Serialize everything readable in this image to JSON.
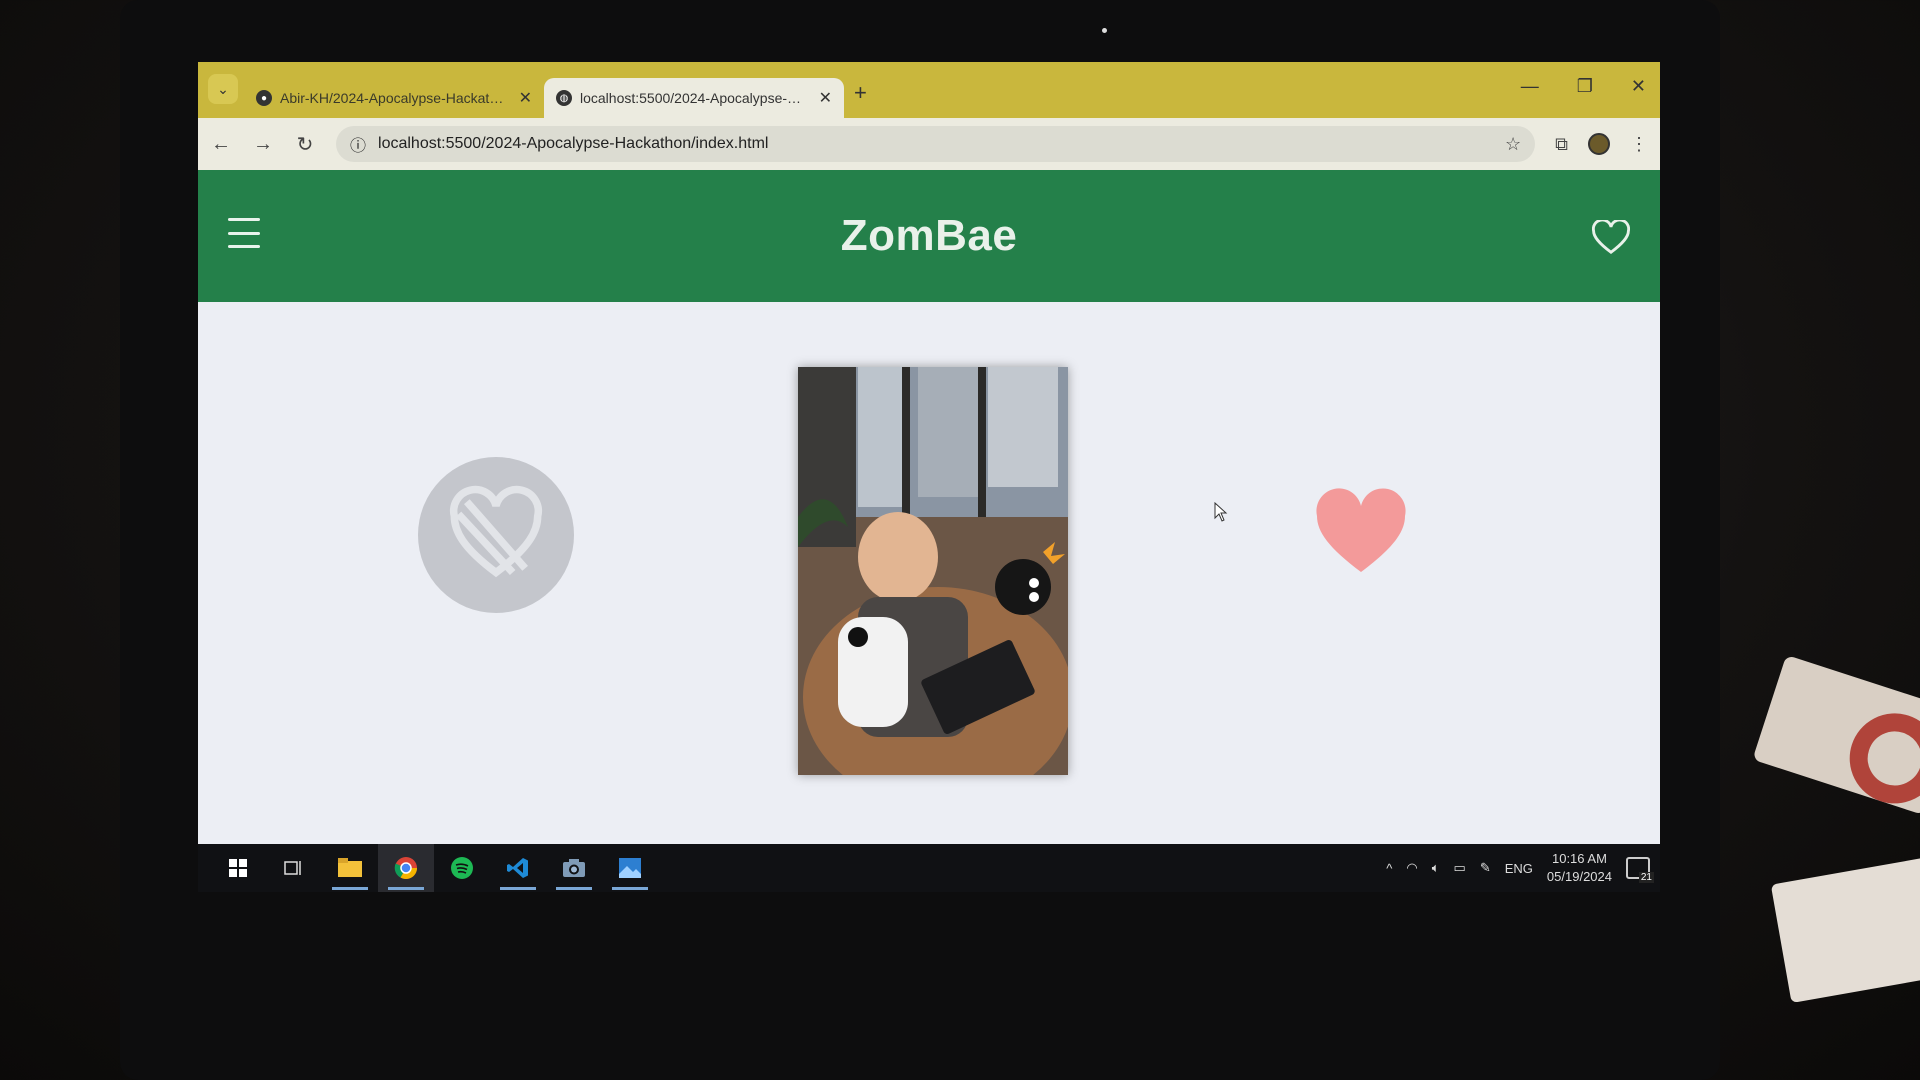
{
  "browser": {
    "tabs": [
      {
        "label": "Abir-KH/2024-Apocalypse-Hackathon",
        "favicon": "github-icon",
        "active": false
      },
      {
        "label": "localhost:5500/2024-Apocalypse-Hackathon/index.html",
        "favicon": "globe-icon",
        "active": true
      }
    ],
    "new_tab_symbol": "+",
    "url": "localhost:5500/2024-Apocalypse-Hackathon/index.html",
    "tab_color": "#c9b73d"
  },
  "app": {
    "title": "ZomBae",
    "header_color": "#24804a",
    "like_color": "#f39a9a"
  },
  "taskbar": {
    "apps": [
      "windows-start-icon",
      "task-view-icon",
      "file-explorer-icon",
      "chrome-icon",
      "spotify-icon",
      "vscode-icon",
      "camera-icon",
      "photos-icon"
    ],
    "language": "ENG",
    "time": "10:16 AM",
    "date": "05/19/2024",
    "notification_count": "21"
  }
}
